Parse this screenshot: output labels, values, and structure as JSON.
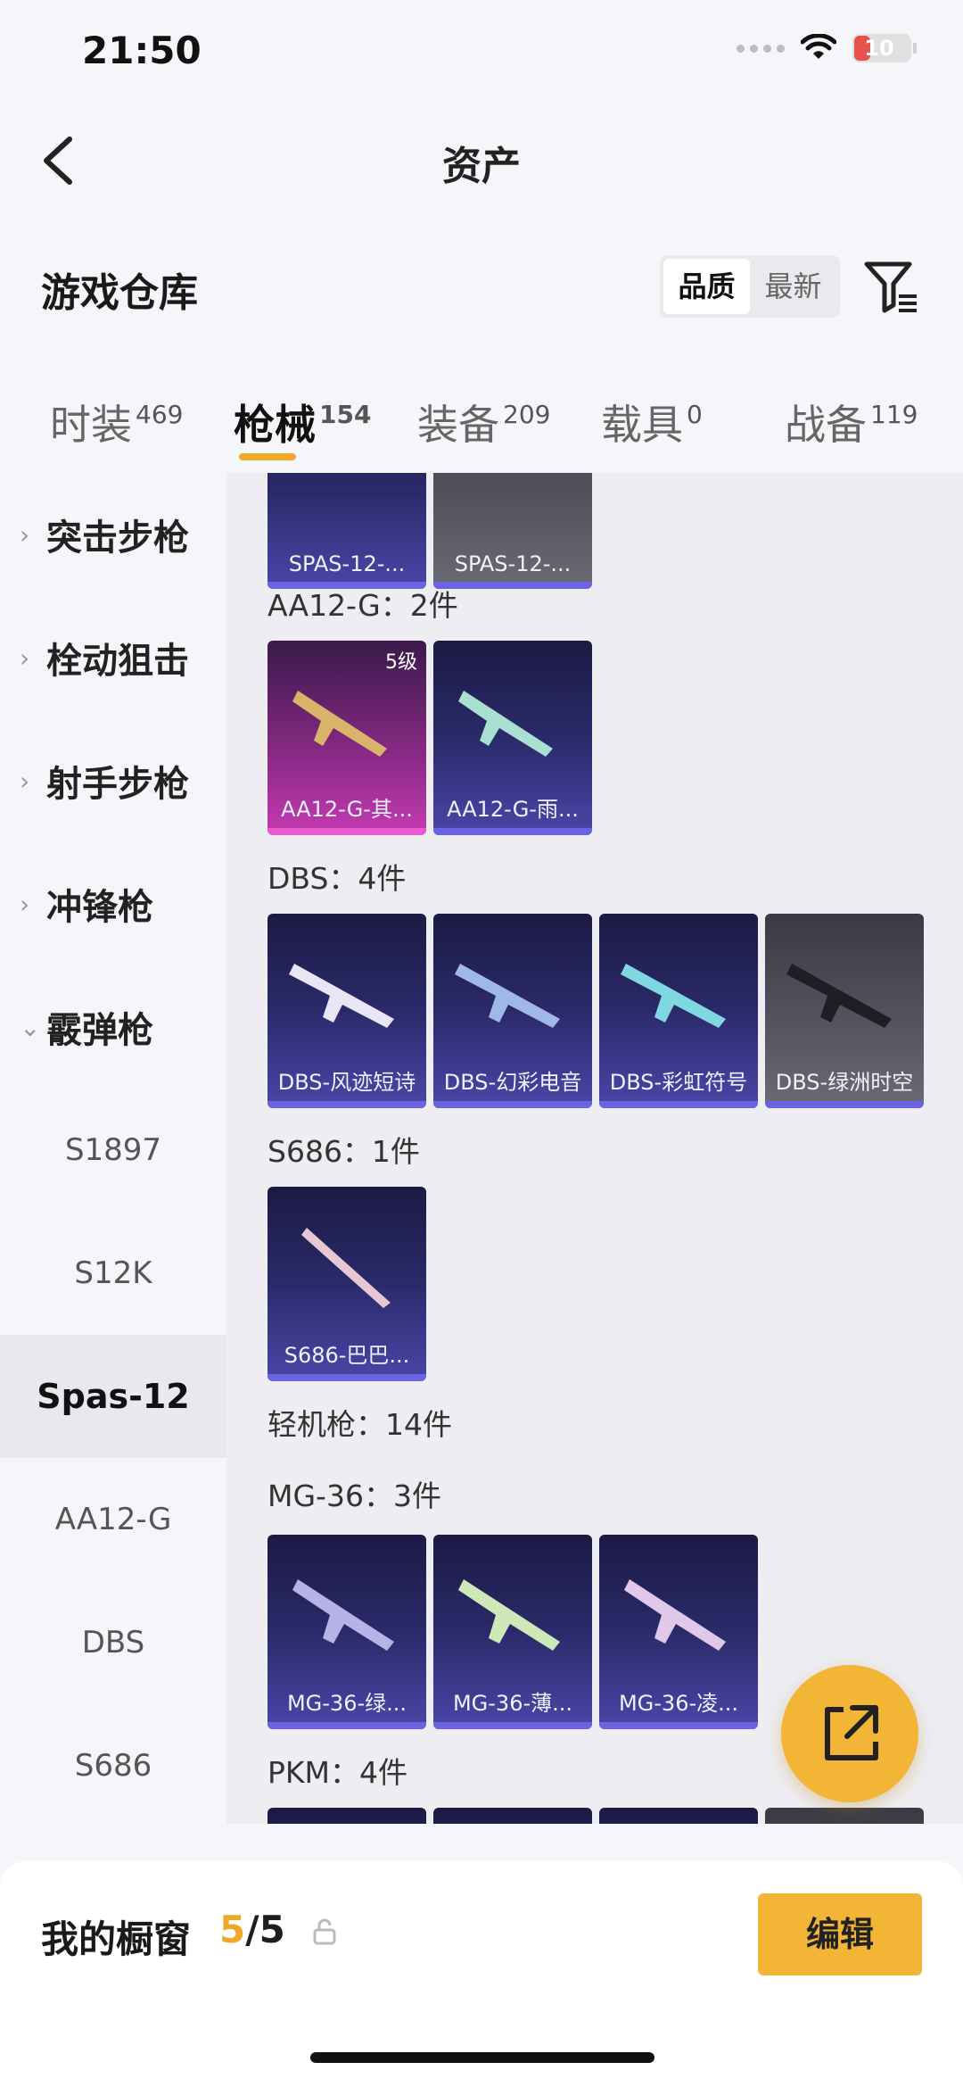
{
  "status_bar": {
    "time": "21:50",
    "battery": "10"
  },
  "nav": {
    "title": "资产"
  },
  "warehouse": {
    "title": "游戏仓库",
    "sort_options": [
      "品质",
      "最新"
    ],
    "active_sort": "品质"
  },
  "tabs": [
    {
      "label": "时装",
      "count": "469"
    },
    {
      "label": "枪械",
      "count": "154"
    },
    {
      "label": "装备",
      "count": "209"
    },
    {
      "label": "载具",
      "count": "0"
    },
    {
      "label": "战备",
      "count": "119"
    }
  ],
  "active_tab": "枪械",
  "sidebar": {
    "categories": [
      "突击步枪",
      "栓动狙击",
      "射手步枪",
      "冲锋枪",
      "霰弹枪"
    ],
    "subitems": [
      "S1897",
      "S12K",
      "Spas-12",
      "AA12-G",
      "DBS",
      "S686"
    ],
    "selected": "Spas-12"
  },
  "content": {
    "top_cards": [
      "SPAS-12-...",
      "SPAS-12-..."
    ],
    "groups": [
      {
        "label": "AA12-G：2件",
        "cards": [
          {
            "name": "AA12-G-其...",
            "level": "5级",
            "style": "gold"
          },
          {
            "name": "AA12-G-雨...",
            "style": "purple"
          }
        ]
      },
      {
        "label": "DBS：4件",
        "cards": [
          {
            "name": "DBS-风迹短诗",
            "style": "purple"
          },
          {
            "name": "DBS-幻彩电音",
            "style": "purple"
          },
          {
            "name": "DBS-彩虹符号",
            "style": "purple"
          },
          {
            "name": "DBS-绿洲时空",
            "style": "gray"
          }
        ]
      },
      {
        "label": "S686：1件",
        "cards": [
          {
            "name": "S686-巴巴...",
            "style": "purple"
          }
        ]
      },
      {
        "label": "轻机枪：14件",
        "cards": []
      },
      {
        "label": "MG-36：3件",
        "cards": [
          {
            "name": "MG-36-绿...",
            "style": "purple"
          },
          {
            "name": "MG-36-薄...",
            "style": "purple"
          },
          {
            "name": "MG-36-凌...",
            "style": "purple"
          }
        ]
      },
      {
        "label": "PKM：4件",
        "cards": []
      }
    ]
  },
  "showcase": {
    "title": "我的橱窗",
    "current": "5",
    "total": "/5",
    "edit_label": "编辑"
  }
}
